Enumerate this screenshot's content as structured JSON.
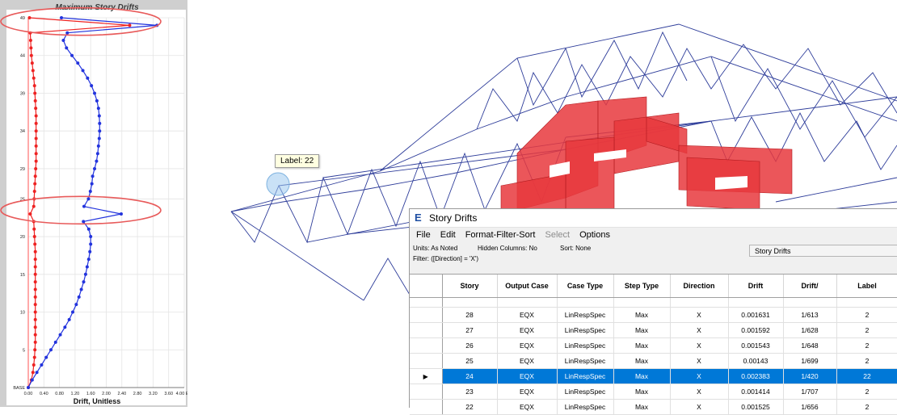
{
  "chart_data": {
    "type": "line",
    "title": "Maximum Story Drifts",
    "xlabel": "Drift, Unitless",
    "x_tick_labels": [
      "0.00",
      "0.40",
      "0.80",
      "1.20",
      "1.60",
      "2.00",
      "2.40",
      "2.80",
      "3.20",
      "3.60",
      "4.00 E-3"
    ],
    "y_tick_labels": [
      "BASE",
      "5",
      "10",
      "15",
      "20",
      "25",
      "29",
      "34",
      "39",
      "44",
      "49"
    ],
    "xlim": [
      0,
      4.0
    ],
    "ylim": [
      0,
      49
    ],
    "grid": true,
    "series": [
      {
        "color": "#ee2222",
        "points": [
          [
            0,
            0
          ],
          [
            0.08,
            1
          ],
          [
            0.12,
            2
          ],
          [
            0.14,
            3
          ],
          [
            0.16,
            4
          ],
          [
            0.17,
            5
          ],
          [
            0.18,
            6
          ],
          [
            0.18,
            7
          ],
          [
            0.18,
            8
          ],
          [
            0.18,
            9
          ],
          [
            0.18,
            10
          ],
          [
            0.18,
            11
          ],
          [
            0.18,
            12
          ],
          [
            0.18,
            13
          ],
          [
            0.18,
            14
          ],
          [
            0.18,
            15
          ],
          [
            0.18,
            16
          ],
          [
            0.18,
            17
          ],
          [
            0.18,
            18
          ],
          [
            0.17,
            19
          ],
          [
            0.16,
            20
          ],
          [
            0.15,
            21
          ],
          [
            0.14,
            22
          ],
          [
            0.05,
            23
          ],
          [
            0.14,
            24
          ],
          [
            0.15,
            25
          ],
          [
            0.16,
            26
          ],
          [
            0.17,
            27
          ],
          [
            0.18,
            28
          ],
          [
            0.19,
            29
          ],
          [
            0.2,
            30
          ],
          [
            0.2,
            31
          ],
          [
            0.2,
            32
          ],
          [
            0.2,
            33
          ],
          [
            0.2,
            34
          ],
          [
            0.2,
            35
          ],
          [
            0.2,
            36
          ],
          [
            0.19,
            37
          ],
          [
            0.18,
            38
          ],
          [
            0.17,
            39
          ],
          [
            0.16,
            40
          ],
          [
            0.14,
            41
          ],
          [
            0.12,
            42
          ],
          [
            0.1,
            43
          ],
          [
            0.08,
            44
          ],
          [
            0.07,
            45
          ],
          [
            0.06,
            46
          ],
          [
            0.05,
            47
          ],
          [
            2.6,
            48
          ],
          [
            0.03,
            49
          ]
        ]
      },
      {
        "color": "#2233dd",
        "points": [
          [
            0,
            0
          ],
          [
            0.1,
            1
          ],
          [
            0.22,
            2
          ],
          [
            0.34,
            3
          ],
          [
            0.46,
            4
          ],
          [
            0.58,
            5
          ],
          [
            0.7,
            6
          ],
          [
            0.82,
            7
          ],
          [
            0.94,
            8
          ],
          [
            1.05,
            9
          ],
          [
            1.14,
            10
          ],
          [
            1.23,
            11
          ],
          [
            1.3,
            12
          ],
          [
            1.36,
            13
          ],
          [
            1.42,
            14
          ],
          [
            1.47,
            15
          ],
          [
            1.51,
            16
          ],
          [
            1.55,
            17
          ],
          [
            1.58,
            18
          ],
          [
            1.6,
            19
          ],
          [
            1.6,
            20
          ],
          [
            1.55,
            21
          ],
          [
            1.414,
            22
          ],
          [
            2.383,
            23
          ],
          [
            1.43,
            24
          ],
          [
            1.543,
            25
          ],
          [
            1.592,
            26
          ],
          [
            1.631,
            27
          ],
          [
            1.65,
            28
          ],
          [
            1.7,
            29
          ],
          [
            1.75,
            30
          ],
          [
            1.78,
            31
          ],
          [
            1.8,
            32
          ],
          [
            1.82,
            33
          ],
          [
            1.83,
            34
          ],
          [
            1.83,
            35
          ],
          [
            1.82,
            36
          ],
          [
            1.8,
            37
          ],
          [
            1.76,
            38
          ],
          [
            1.7,
            39
          ],
          [
            1.62,
            40
          ],
          [
            1.52,
            41
          ],
          [
            1.4,
            42
          ],
          [
            1.27,
            43
          ],
          [
            1.12,
            44
          ],
          [
            0.98,
            45
          ],
          [
            0.9,
            46
          ],
          [
            1.0,
            47
          ],
          [
            3.3,
            48
          ],
          [
            0.85,
            49
          ]
        ]
      }
    ],
    "highlight_ellipses": [
      {
        "story_center": 48.5,
        "color": "#e85a5a"
      },
      {
        "story_center": 23.5,
        "color": "#e85a5a"
      }
    ]
  },
  "tooltip": {
    "text": "Label: 22"
  },
  "window": {
    "icon": "E",
    "title": "Story Drifts",
    "menu": [
      {
        "label": "File",
        "enabled": true
      },
      {
        "label": "Edit",
        "enabled": true
      },
      {
        "label": "Format-Filter-Sort",
        "enabled": true
      },
      {
        "label": "Select",
        "enabled": false
      },
      {
        "label": "Options",
        "enabled": true
      }
    ],
    "units_text": "Units: As Noted",
    "hidden_text": "Hidden Columns: No",
    "sort_text": "Sort: None",
    "filter_text": "Filter: ([Direction] = 'X')",
    "table_name": "Story Drifts"
  },
  "table": {
    "columns": [
      "Story",
      "Output Case",
      "Case Type",
      "Step Type",
      "Direction",
      "Drift",
      "Drift/",
      "Label"
    ],
    "rows": [
      [
        "28",
        "EQX",
        "LinRespSpec",
        "Max",
        "X",
        "0.001631",
        "1/613",
        "2"
      ],
      [
        "27",
        "EQX",
        "LinRespSpec",
        "Max",
        "X",
        "0.001592",
        "1/628",
        "2"
      ],
      [
        "26",
        "EQX",
        "LinRespSpec",
        "Max",
        "X",
        "0.001543",
        "1/648",
        "2"
      ],
      [
        "25",
        "EQX",
        "LinRespSpec",
        "Max",
        "X",
        "0.00143",
        "1/699",
        "2"
      ],
      [
        "24",
        "EQX",
        "LinRespSpec",
        "Max",
        "X",
        "0.002383",
        "1/420",
        "22"
      ],
      [
        "23",
        "EQX",
        "LinRespSpec",
        "Max",
        "X",
        "0.001414",
        "1/707",
        "2"
      ],
      [
        "22",
        "EQX",
        "LinRespSpec",
        "Max",
        "X",
        "0.001525",
        "1/656",
        "2"
      ]
    ],
    "selected_row": 4,
    "row_marker": "▶"
  }
}
